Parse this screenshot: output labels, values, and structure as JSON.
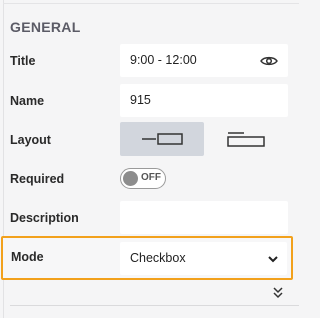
{
  "section": {
    "title": "GENERAL"
  },
  "fields": {
    "title": {
      "label": "Title",
      "value": "9:00 - 12:00"
    },
    "name": {
      "label": "Name",
      "value": "915"
    },
    "layout": {
      "label": "Layout",
      "options": [
        "label-beside-input",
        "label-above-input"
      ],
      "selected": "label-beside-input"
    },
    "required": {
      "label": "Required",
      "toggle_text": "OFF",
      "on": false
    },
    "description": {
      "label": "Description",
      "value": ""
    },
    "mode": {
      "label": "Mode",
      "value": "Checkbox"
    }
  },
  "colors": {
    "highlight": "#f2a11c",
    "panel_bg": "#f5f5f6",
    "selected_bg": "#d2d6dd"
  },
  "icons": {
    "visibility": "eye-icon",
    "dropdown": "chevron-down-icon",
    "expand": "double-chevron-down-icon"
  }
}
